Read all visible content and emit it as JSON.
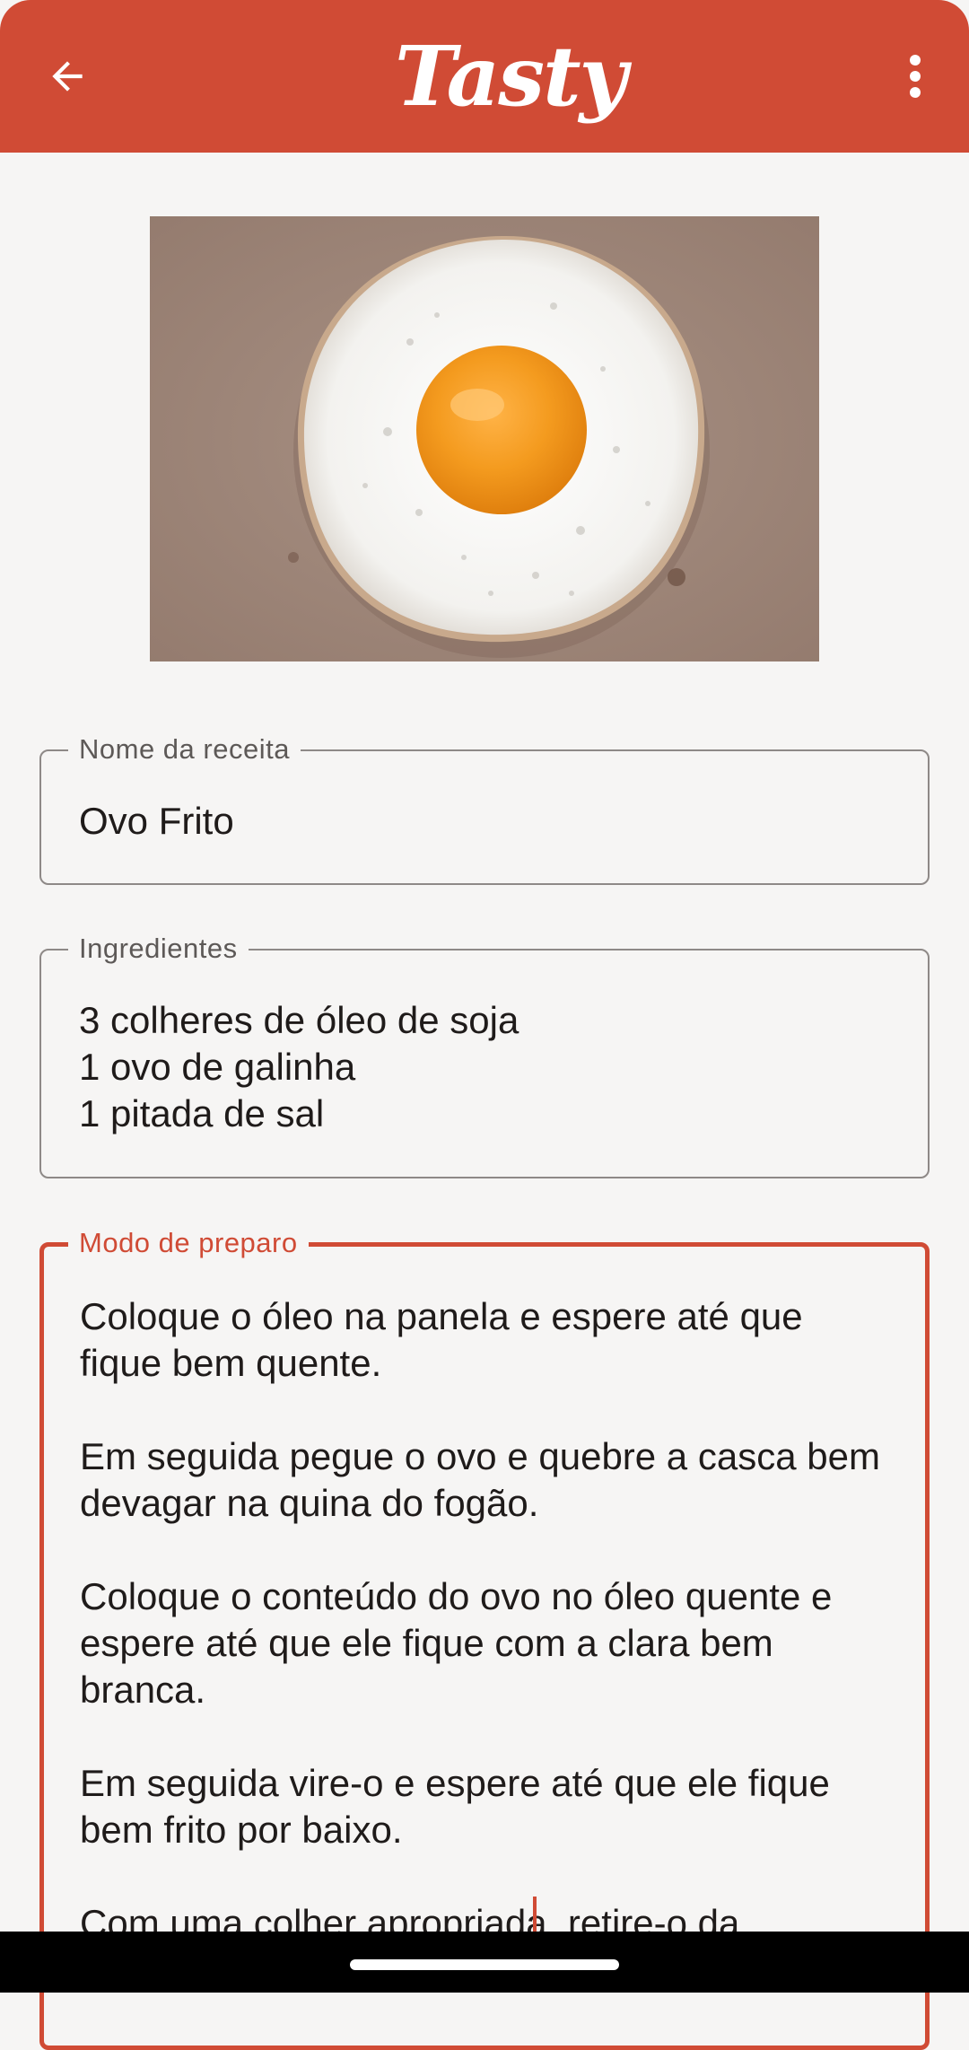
{
  "app_bar": {
    "title": "Tasty",
    "back_icon": "arrow-back-icon",
    "more_icon": "more-vert-icon",
    "background": "#D04B35"
  },
  "hero_image": {
    "subject": "fried-egg-photo"
  },
  "form": {
    "name": {
      "label": "Nome da receita",
      "value": "Ovo Frito"
    },
    "ingredients": {
      "label": "Ingredientes",
      "value": "3 colheres de óleo de soja\n1 ovo de galinha\n1 pitada de sal"
    },
    "preparation": {
      "label": "Modo de preparo",
      "value": "Coloque o óleo na panela e espere até que fique bem quente.\n\nEm seguida pegue o ovo e quebre a casca bem devagar na quina do fogão.\n\nColoque o conteúdo do ovo no óleo quente e espere até que ele fique com a clara bem branca.\n\nEm seguida vire-o e espere até que ele fique bem frito por baixo.\n\nCom uma colher apropriada, retire-o da",
      "focused": true
    }
  },
  "colors": {
    "accent": "#D04B35",
    "background": "#F6F5F4",
    "outline": "#8E8987",
    "text": "#1F1B1A"
  }
}
